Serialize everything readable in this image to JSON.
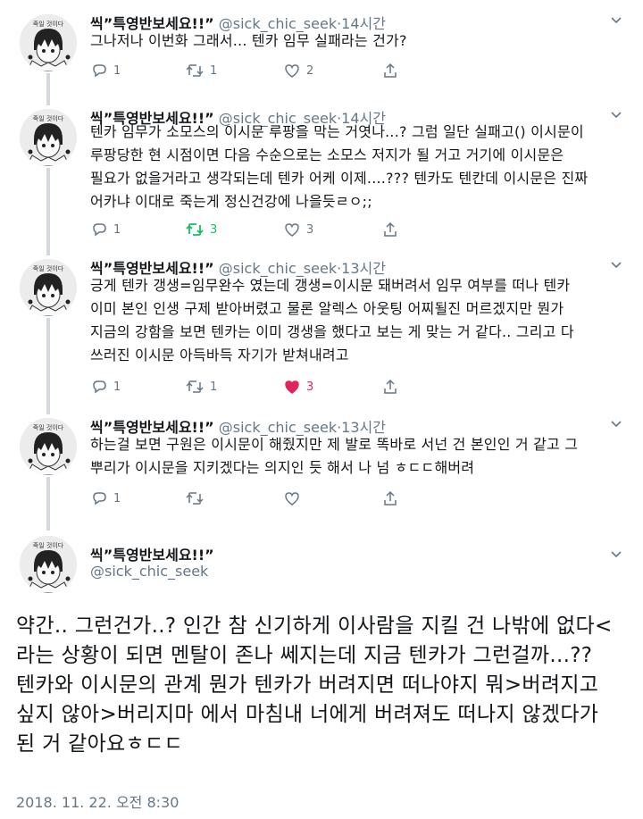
{
  "tweets": [
    {
      "name": "씩”특영반보세요!!”",
      "handle": "@sick_chic_seek",
      "time": "14시간",
      "text": "그나저나 이번화 그래서... 텐카 임무 실패라는 건가?",
      "reply_count": "1",
      "retweet_count": "1",
      "like_count": "2",
      "liked": false,
      "retweeted": false
    },
    {
      "name": "씩”특영반보세요!!”",
      "handle": "@sick_chic_seek",
      "time": "14시간",
      "text": "텐카 임무가 소모스의 이시문 루팡을 막는 거엿나...? 그럼 일단 실패고() 이시문이\n루팡당한 현 시점이면 다음 수순으로는 소모스 저지가 될 거고 거기에 이시문은\n필요가 없을거라고 생각되는데 텐카 어케 이제....??? 텐카도 텐칸데 이시문은 진짜\n어카냐 이대로 죽는게 정신건강에 나을듯ㄹㅇ;;",
      "reply_count": "1",
      "retweet_count": "3",
      "like_count": "3",
      "liked": false,
      "retweeted": true
    },
    {
      "name": "씩”특영반보세요!!”",
      "handle": "@sick_chic_seek",
      "time": "13시간",
      "text": "긍게 텐카 갱생=임무완수 였는데 갱생=이시문 돼버려서 임무 여부를 떠나 텐카\n이미 본인 인생 구제 받아버렸고 물론 알렉스 아웃팅 어찌될진 머르겠지만 뭔가\n지금의 강함을 보면 텐카는 이미 갱생을 했다고 보는 게 맞는 거 같다.. 그리고 다\n쓰러진 이시문 아득바득 자기가 받쳐내려고",
      "reply_count": "1",
      "retweet_count": "1",
      "like_count": "3",
      "liked": true,
      "retweeted": false
    },
    {
      "name": "씩”특영반보세요!!”",
      "handle": "@sick_chic_seek",
      "time": "13시간",
      "text": "하는걸 보면 구원은 이시문이 해줬지만 제 발로 똑바로 서넌 건 본인인 거 같고 그\n뿌리가 이시문을 지키겠다는 의지인 듯 해서 나 넘 ㅎㄷㄷ해버려",
      "reply_count": "1",
      "retweet_count": "",
      "like_count": "",
      "liked": false,
      "retweeted": false
    }
  ],
  "main_tweet": {
    "name": "씩”특영반보세요!!”",
    "handle": "@sick_chic_seek",
    "text": "약간.. 그런건가..? 인간 참 신기하게 이사람을 지킬 건 나밖에 없다<\n라는 상황이 되면 멘탈이 존나 쎄지는데 지금 텐카가 그런걸까...??\n텐카와 이시문의 관계 뭔가 텐카가 버려지면 떠나야지 뭐>버려지고\n싶지 않아>버리지마 에서 마침내 너에게 버려져도 떠나지 않겠다가\n된 거 같아요ㅎㄷㄷ",
    "timestamp": "2018. 11. 22. 오전 8:30"
  },
  "avatar_text": "죽일 것이다",
  "colors": {
    "text": "#14171a",
    "secondary": "#657786",
    "retweet_green": "#17bf63",
    "like_red": "#e0245e",
    "thread_line": "#d3d9de"
  },
  "icons": [
    "reply-icon",
    "retweet-icon",
    "like-icon",
    "share-icon",
    "caret-down-icon"
  ]
}
